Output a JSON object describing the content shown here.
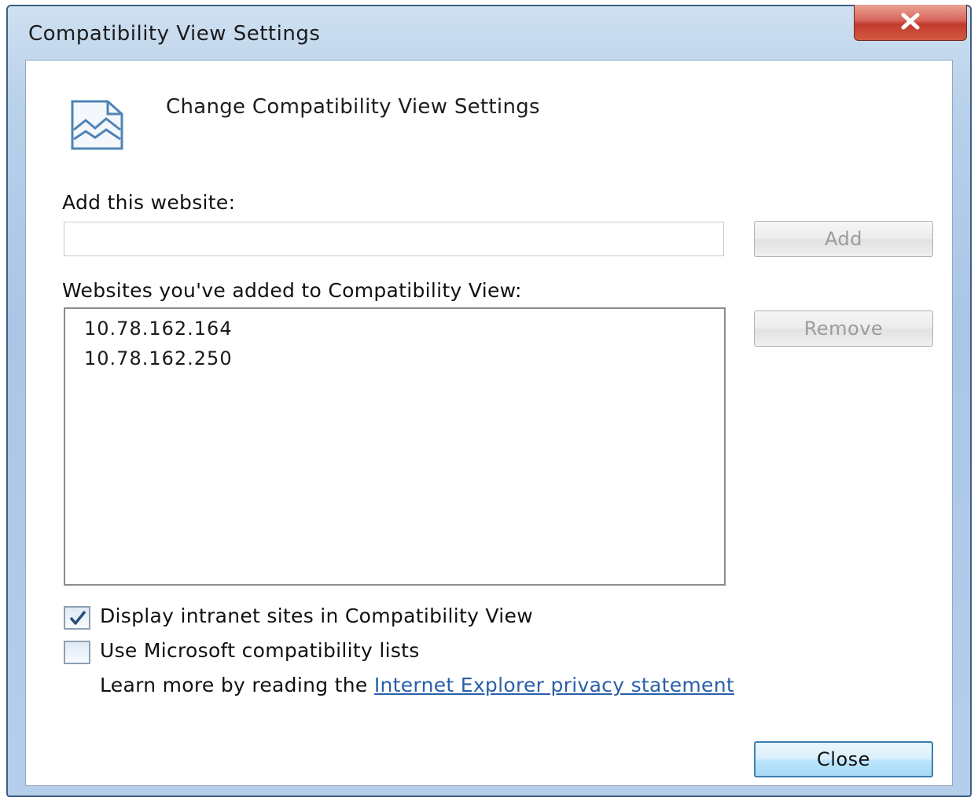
{
  "window": {
    "title": "Compatibility View Settings"
  },
  "header": {
    "text": "Change Compatibility View Settings",
    "icon": "compatibility-view-icon"
  },
  "add_section": {
    "label": "Add this website:",
    "input_value": "",
    "add_button": "Add"
  },
  "list_section": {
    "label": "Websites you've added to Compatibility View:",
    "items": [
      "10.78.162.164",
      "10.78.162.250"
    ],
    "remove_button": "Remove"
  },
  "options": {
    "intranet": {
      "label": "Display intranet sites in Compatibility View",
      "checked": true
    },
    "ms_lists": {
      "label": "Use Microsoft compatibility lists",
      "checked": false
    }
  },
  "learn_more": {
    "prefix": "Learn more by reading the",
    "link": "Internet Explorer privacy statement"
  },
  "footer": {
    "close_button": "Close"
  },
  "colors": {
    "link": "#2a5fa8",
    "close_button_border": "#3c7fb1",
    "title_close": "#c23b2e"
  }
}
